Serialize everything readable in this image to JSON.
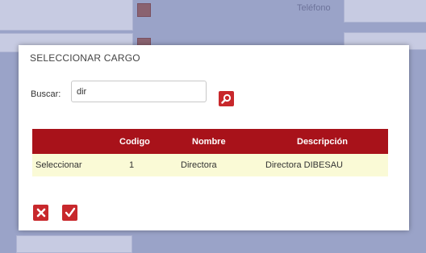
{
  "background": {
    "field_label_1": "Teléfono"
  },
  "dialog": {
    "title": "SELECCIONAR CARGO",
    "search": {
      "label": "Buscar:",
      "value": "dir"
    },
    "table": {
      "headers": [
        "",
        "Codigo",
        "Nombre",
        "Descripción"
      ],
      "rows": [
        {
          "action": "Seleccionar",
          "codigo": "1",
          "nombre": "Directora",
          "descripcion": "Directora DIBESAU"
        }
      ]
    }
  },
  "icons": {
    "search": "search-icon",
    "cancel": "close-icon",
    "confirm": "check-icon"
  },
  "colors": {
    "accent": "#c8282c",
    "header_bg": "#a8121a",
    "row_bg": "#fafad6",
    "overlay": "#9aa3c8"
  }
}
